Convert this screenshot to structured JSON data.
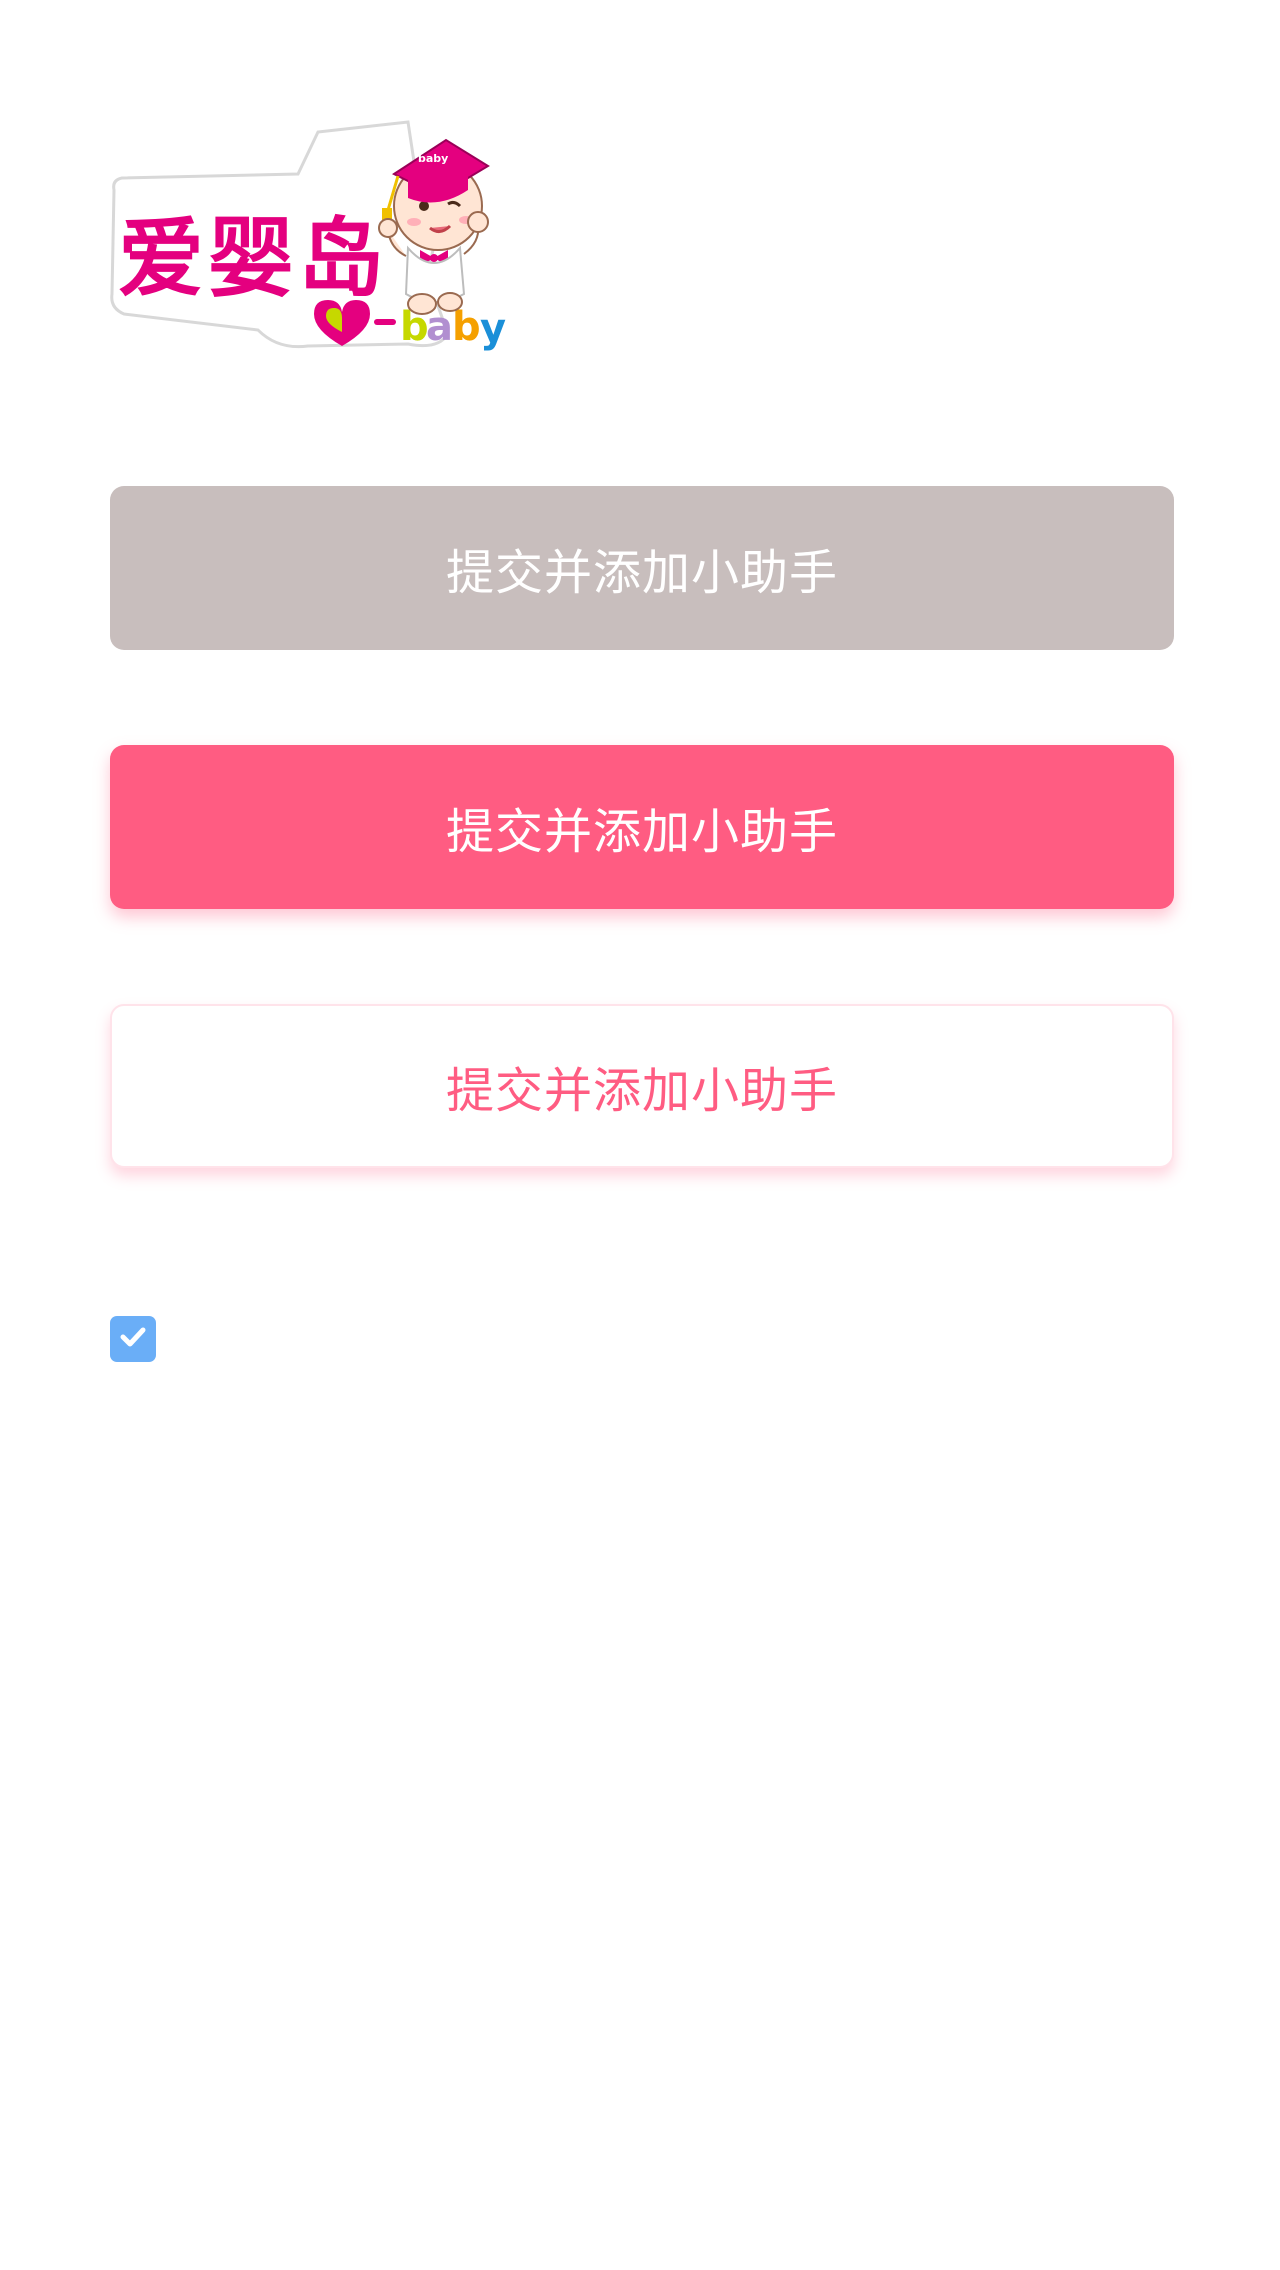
{
  "logo": {
    "brand_text": "爱婴岛",
    "sub_text": "baby",
    "cap_text": "baby"
  },
  "buttons": {
    "disabled_label": "提交并添加小助手",
    "primary_label": "提交并添加小助手",
    "outline_label": "提交并添加小助手"
  },
  "checkbox": {
    "checked": true,
    "icon": "check-icon"
  },
  "colors": {
    "primary": "#ff5c82",
    "disabled": "#c8bebd",
    "checkbox": "#6aaef7",
    "logo_magenta": "#e4007f"
  }
}
